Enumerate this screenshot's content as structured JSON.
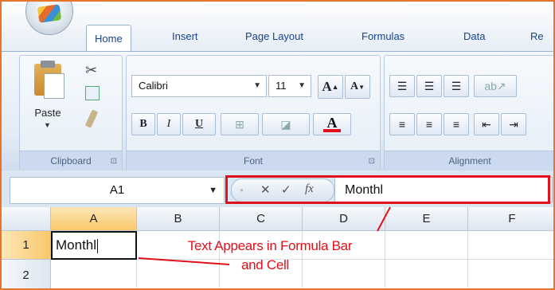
{
  "ribbon_tabs": [
    "Home",
    "Insert",
    "Page Layout",
    "Formulas",
    "Data",
    "Re"
  ],
  "clipboard": {
    "paste_label": "Paste",
    "group_label": "Clipboard",
    "launcher": "⊡"
  },
  "font": {
    "name": "Calibri",
    "size": "11",
    "group_label": "Font",
    "bold": "B",
    "italic": "I",
    "underline": "U",
    "grow": "A",
    "shrink": "A",
    "font_color": "A"
  },
  "alignment": {
    "group_label": "Alignment"
  },
  "name_box": {
    "value": "A1"
  },
  "formula_bar": {
    "value": "Monthl",
    "cancel": "✕",
    "enter": "✓",
    "fx": "fx"
  },
  "columns": [
    "A",
    "B",
    "C",
    "D",
    "E",
    "F"
  ],
  "rows": [
    "1",
    "2"
  ],
  "cells": {
    "A1": "Monthl"
  },
  "annotation": {
    "line1": "Text Appears in Formula Bar",
    "line2": "and Cell"
  },
  "colors": {
    "frame": "#e8742a",
    "highlight": "#e0111b",
    "selected_header": "#f9c86b"
  }
}
